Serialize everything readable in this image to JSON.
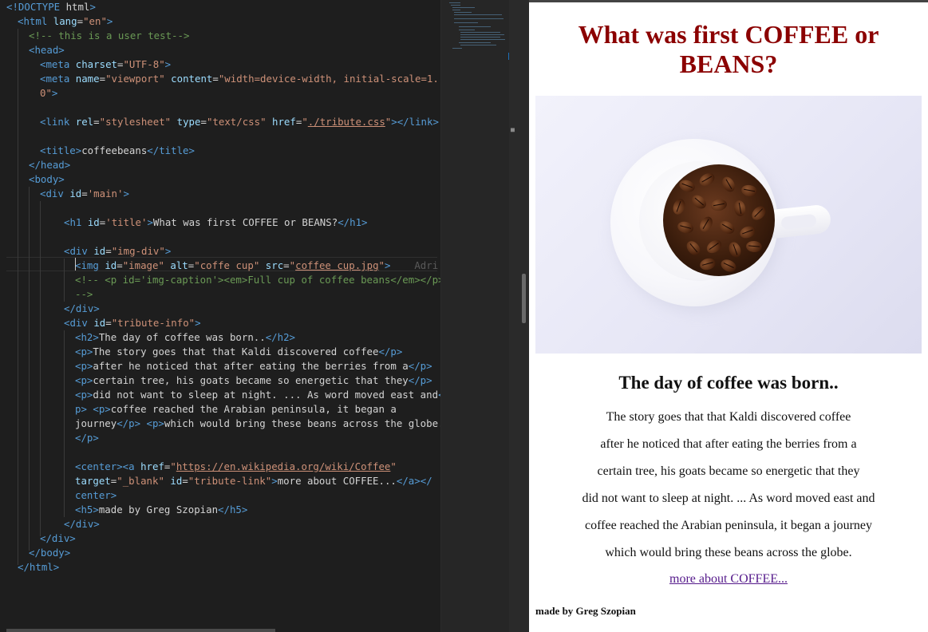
{
  "editor": {
    "code_lines": [
      "<!DOCTYPE html>",
      "<html lang=\"en\">",
      "<!-- this is a user test-->",
      "<head>",
      "<meta charset=\"UTF-8\">",
      "<meta name=\"viewport\" content=\"width=device-width, initial-scale=1.",
      "0\">",
      "<link rel=\"stylesheet\" type=\"text/css\" href=\"./tribute.css\"></link>",
      "<title>coffeebeans</title>",
      "</head>",
      "<body>",
      "<div id='main'>",
      "<h1 id='title'>What was first COFFEE or BEANS?</h1>",
      "<div id=\"img-div\">",
      "<img id=\"image\" alt=\"coffe cup\" src=\"coffee cup.jpg\">",
      "<!-- <p id='img-caption'><em>Full cup of coffee beans</em></p>",
      "-->",
      "</div>",
      "<div id=\"tribute-info\">",
      "<h2>The day of coffee was born..</h2>",
      "<p>The story goes that that Kaldi discovered coffee</p>",
      "<p>after he noticed that after eating the berries from a</p>",
      "<p>certain tree, his goats became so energetic that they</p>",
      "<p>did not want to sleep at night. ... As word moved east and</",
      "p> <p>coffee reached the Arabian peninsula, it began a",
      "journey</p> <p>which would bring these beans across the globe.",
      "</p>",
      "<center><a href=\"https://en.wikipedia.org/wiki/Coffee\"",
      "target=\"_blank\" id=\"tribute-link\">more about COFFEE...</a></",
      "center>",
      "<h5>made by Greg Szopian</h5>",
      "</div>",
      "</div>",
      "</body>",
      "</html>"
    ],
    "ghost_text": "Adri"
  },
  "preview": {
    "title": "What was first COFFEE or BEANS?",
    "image_alt": "coffe cup",
    "heading": "The day of coffee was born..",
    "paragraphs": [
      "The story goes that that Kaldi discovered coffee",
      "after he noticed that after eating the berries from a",
      "certain tree, his goats became so energetic that they",
      "did not want to sleep at night. ... As word moved east and",
      "coffee reached the Arabian peninsula, it began a journey",
      "which would bring these beans across the globe."
    ],
    "link_text": "more about COFFEE...",
    "credit": "made by Greg Szopian"
  },
  "colors": {
    "title": "#8b0000",
    "link": "#551a8b",
    "editor_bg": "#1e1e1e"
  }
}
